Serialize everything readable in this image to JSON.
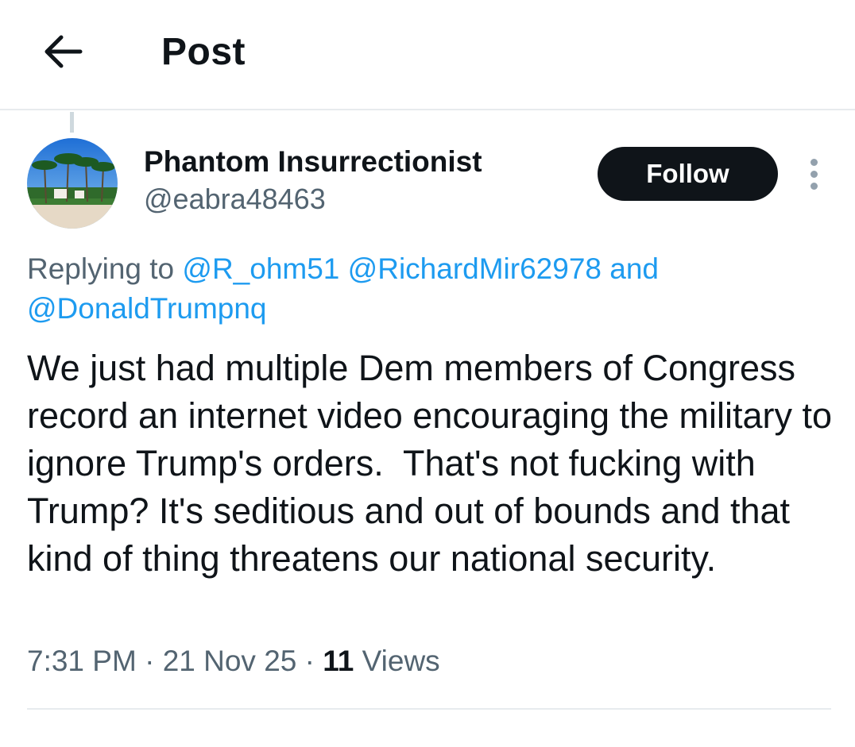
{
  "header": {
    "title": "Post",
    "back_icon": "arrow-left-icon"
  },
  "post": {
    "author": {
      "name": "Phantom Insurrectionist",
      "handle": "@eabra48463",
      "avatar": "palm-trees-photo"
    },
    "follow_label": "Follow",
    "more_icon": "more-vertical-icon",
    "reply_prefix": "Replying to",
    "reply_mentions": [
      "@R_ohm51",
      "@RichardMir62978",
      "@DonaldTrumpnq"
    ],
    "reply_conjunction": "and",
    "text": "We just had multiple Dem members of Congress record an internet video encouraging the military to ignore Trump's orders.  That's not fucking with Trump? It's seditious and out of bounds and that kind of thing threatens our national security.",
    "time": "7:31 PM",
    "date": "21 Nov 25",
    "separator": "·",
    "views_count": "11",
    "views_label": "Views"
  },
  "colors": {
    "text": "#0f1419",
    "secondary": "#536471",
    "link": "#1d9bf0",
    "button": "#0f1419",
    "divider": "#e7ebee"
  }
}
